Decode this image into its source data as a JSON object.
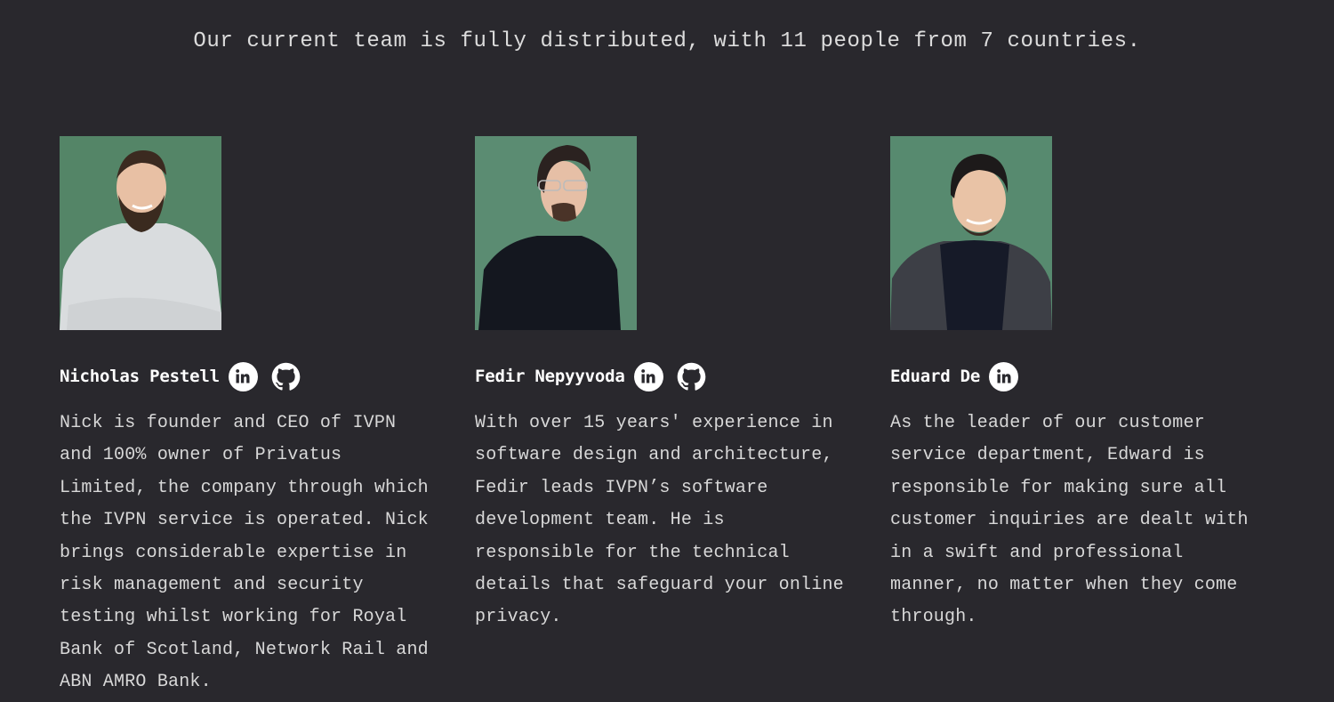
{
  "intro": "Our current team is fully distributed, with 11 people from 7 countries.",
  "colors": {
    "background": "#29282d",
    "text": "#d8d8d8",
    "photo_background": "#5a8a70"
  },
  "team": [
    {
      "name": "Nicholas Pestell",
      "photo_alt": "Portrait of Nicholas Pestell",
      "socials": [
        "linkedin-icon",
        "github-icon"
      ],
      "bio": "Nick is founder and CEO of IVPN and 100% owner of Privatus Limited, the company through which the IVPN service is operated. Nick brings considerable expertise in risk management and security testing whilst working for Royal Bank of Scotland, Network Rail and ABN AMRO Bank."
    },
    {
      "name": "Fedir Nepyyvoda",
      "photo_alt": "Portrait of Fedir Nepyyvoda",
      "socials": [
        "linkedin-icon",
        "github-icon"
      ],
      "bio": "With over 15 years' experience in software design and architecture, Fedir leads IVPN’s software development team. He is responsible for the technical details that safeguard your online privacy."
    },
    {
      "name": "Eduard De",
      "photo_alt": "Portrait of Eduard De",
      "socials": [
        "linkedin-icon"
      ],
      "bio": "As the leader of our customer service department, Edward is responsible for making sure all customer inquiries are dealt with in a swift and professional manner, no matter when they come through."
    }
  ]
}
